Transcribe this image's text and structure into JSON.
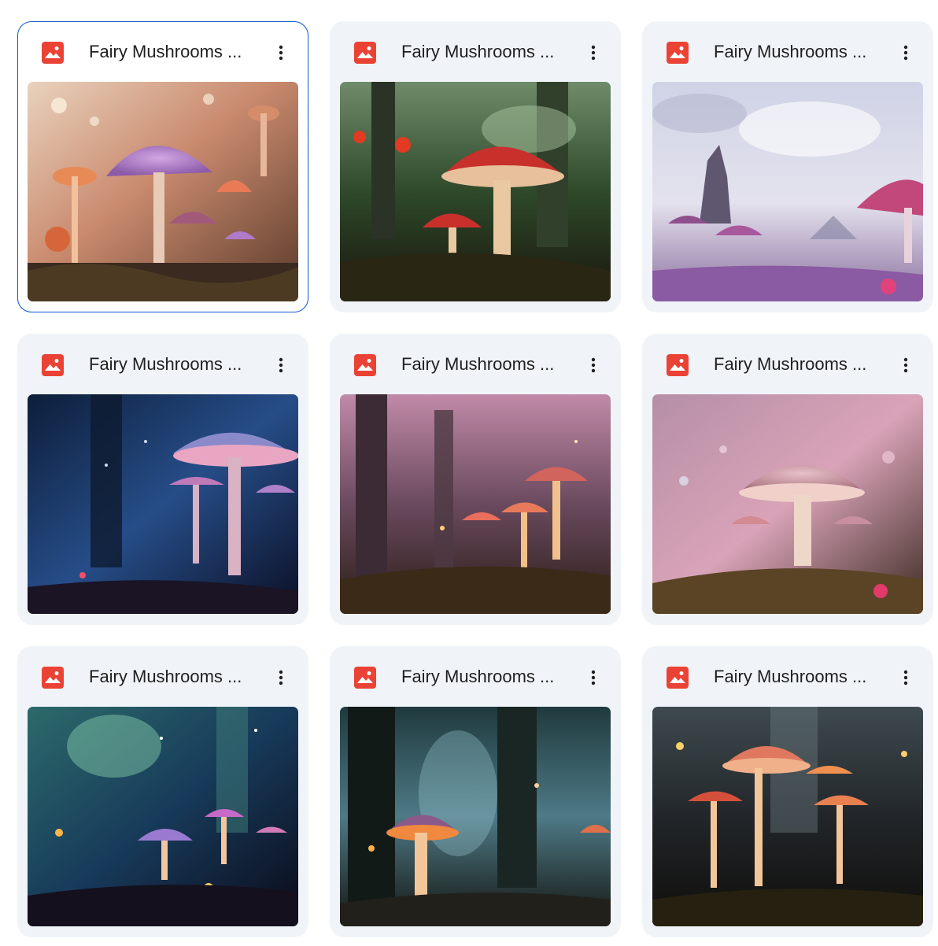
{
  "files": [
    {
      "title": "Fairy Mushrooms ...",
      "selected": true,
      "type_icon": "image-file-icon",
      "menu_icon": "more-vert-icon"
    },
    {
      "title": "Fairy Mushrooms ...",
      "selected": false,
      "type_icon": "image-file-icon",
      "menu_icon": "more-vert-icon"
    },
    {
      "title": "Fairy Mushrooms ...",
      "selected": false,
      "type_icon": "image-file-icon",
      "menu_icon": "more-vert-icon"
    },
    {
      "title": "Fairy Mushrooms ...",
      "selected": false,
      "type_icon": "image-file-icon",
      "menu_icon": "more-vert-icon"
    },
    {
      "title": "Fairy Mushrooms ...",
      "selected": false,
      "type_icon": "image-file-icon",
      "menu_icon": "more-vert-icon"
    },
    {
      "title": "Fairy Mushrooms ...",
      "selected": false,
      "type_icon": "image-file-icon",
      "menu_icon": "more-vert-icon"
    },
    {
      "title": "Fairy Mushrooms ...",
      "selected": false,
      "type_icon": "image-file-icon",
      "menu_icon": "more-vert-icon"
    },
    {
      "title": "Fairy Mushrooms ...",
      "selected": false,
      "type_icon": "image-file-icon",
      "menu_icon": "more-vert-icon"
    },
    {
      "title": "Fairy Mushrooms ...",
      "selected": false,
      "type_icon": "image-file-icon",
      "menu_icon": "more-vert-icon"
    }
  ],
  "colors": {
    "card_bg": "#f0f4f9",
    "selected_border": "#0b57d0",
    "image_icon_red": "#ea4335",
    "title_text": "#1f1f1f"
  }
}
